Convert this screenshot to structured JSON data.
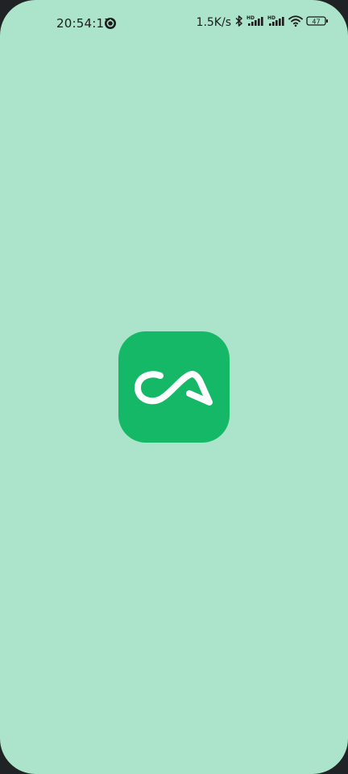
{
  "status_bar": {
    "time": "20:54:17",
    "network_speed": "1.5K/s",
    "network_1_label": "HD",
    "network_2_label": "HD",
    "battery_level": "47",
    "icons": [
      "sync-icon",
      "bluetooth-icon",
      "signal-icon",
      "signal-icon",
      "wifi-icon",
      "battery-icon"
    ]
  },
  "splash": {
    "logo_name": "app-logo",
    "logo_color": "#14b867",
    "background_color": "#abe3cb"
  }
}
